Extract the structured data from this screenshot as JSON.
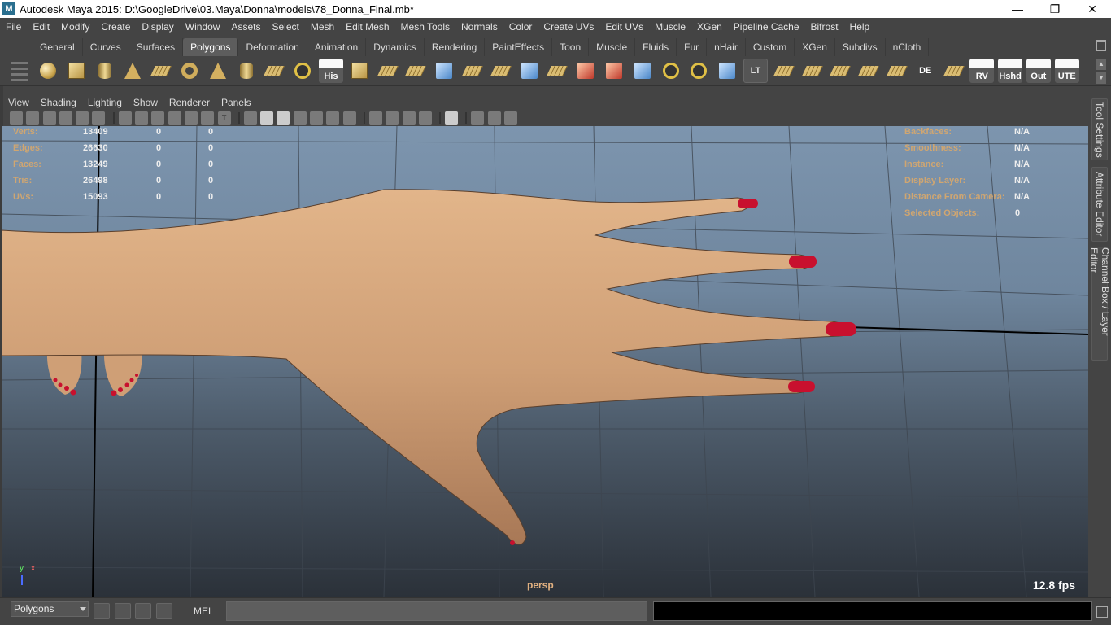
{
  "window": {
    "title": "Autodesk Maya 2015: D:\\GoogleDrive\\03.Maya\\Donna\\models\\78_Donna_Final.mb*",
    "app_icon": "M",
    "minimize_glyph": "—",
    "restore_glyph": "❐",
    "close_glyph": "✕"
  },
  "menubar": [
    "File",
    "Edit",
    "Modify",
    "Create",
    "Display",
    "Window",
    "Assets",
    "Select",
    "Mesh",
    "Edit Mesh",
    "Mesh Tools",
    "Normals",
    "Color",
    "Create UVs",
    "Edit UVs",
    "Muscle",
    "XGen",
    "Pipeline Cache",
    "Bifrost",
    "Help"
  ],
  "shelf_tabs": {
    "items": [
      "General",
      "Curves",
      "Surfaces",
      "Polygons",
      "Deformation",
      "Animation",
      "Dynamics",
      "Rendering",
      "PaintEffects",
      "Toon",
      "Muscle",
      "Fluids",
      "Fur",
      "nHair",
      "Custom",
      "XGen",
      "Subdivs",
      "nCloth"
    ],
    "active": "Polygons"
  },
  "shelf_icons": {
    "his": "His",
    "lt": "LT",
    "de": "DE",
    "rv": "RV",
    "hshd": "Hshd",
    "out": "Out",
    "ute": "UTE"
  },
  "panel_menu": [
    "View",
    "Shading",
    "Lighting",
    "Show",
    "Renderer",
    "Panels"
  ],
  "panel_tool_text_icon": "T",
  "hud_left": [
    {
      "label": "Verts:",
      "v1": "13409",
      "v2": "0",
      "v3": "0"
    },
    {
      "label": "Edges:",
      "v1": "26630",
      "v2": "0",
      "v3": "0"
    },
    {
      "label": "Faces:",
      "v1": "13249",
      "v2": "0",
      "v3": "0"
    },
    {
      "label": "Tris:",
      "v1": "26498",
      "v2": "0",
      "v3": "0"
    },
    {
      "label": "UVs:",
      "v1": "15093",
      "v2": "0",
      "v3": "0"
    }
  ],
  "hud_right": [
    {
      "label": "Backfaces:",
      "value": "N/A"
    },
    {
      "label": "Smoothness:",
      "value": "N/A"
    },
    {
      "label": "Instance:",
      "value": "N/A"
    },
    {
      "label": "Display Layer:",
      "value": "N/A"
    },
    {
      "label": "Distance From Camera:",
      "value": "N/A"
    },
    {
      "label": "Selected Objects:",
      "value": "0"
    }
  ],
  "viewport": {
    "camera": "persp",
    "fps": "12.8 fps",
    "axis_y": "y",
    "axis_x": "x",
    "skin_color": "#cf9f76",
    "nail_color": "#c8102e"
  },
  "side_tabs": [
    "Tool Settings",
    "Attribute Editor",
    "Channel Box / Layer Editor"
  ],
  "command": {
    "mode": "Polygons",
    "mel_label": "MEL",
    "input_value": "",
    "result_value": ""
  }
}
